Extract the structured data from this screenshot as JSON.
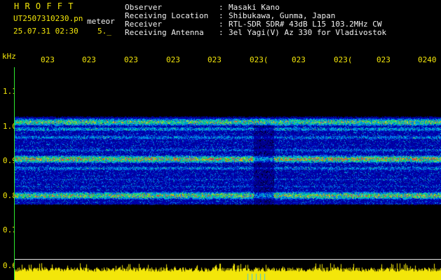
{
  "header": {
    "brand": "H R O F F T",
    "filename": "UT2507310230.pn",
    "mode": "meteor",
    "datetime": "25.07.31 02:30",
    "count": "5._"
  },
  "station": [
    {
      "label": "Observer",
      "value": "Masaki Kano"
    },
    {
      "label": "Receiving Location",
      "value": "Shibukawa, Gunma, Japan"
    },
    {
      "label": "Receiver",
      "value": "RTL-SDR SDR# 43dB L15 103.2MHz CW"
    },
    {
      "label": "Receiving Antenna",
      "value": "3el Yagi(V) Az 330 for Vladivostok"
    }
  ],
  "plot": {
    "y_unit": "kHz",
    "y_ticks": [
      "1.1",
      "1.0",
      "0.9",
      "0.8",
      "0.7",
      "0.6"
    ],
    "x_ticks": [
      "023",
      "023",
      "023",
      "023",
      "023",
      "023(",
      "023",
      "023(",
      "023",
      "0240"
    ],
    "colors": {
      "axis": "#2ee82e",
      "labels": "#f3e60a",
      "power": "#f3e60a",
      "baseline": "#e8e8e8"
    }
  }
}
